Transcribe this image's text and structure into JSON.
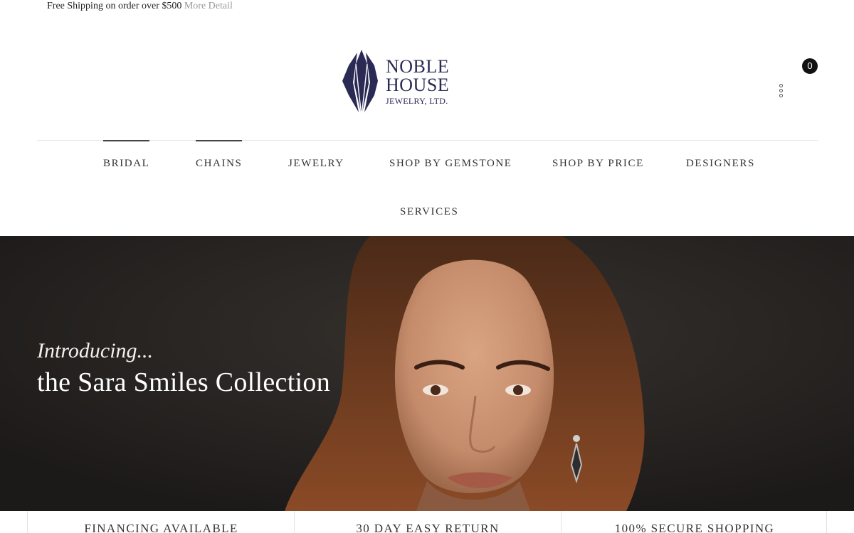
{
  "topbar": {
    "text": "Free Shipping on order over $500",
    "link": "More Detail"
  },
  "logo": {
    "line1": "NOBLE",
    "line2": "HOUSE",
    "line3": "JEWELRY, LTD.",
    "color": "#2a2a55"
  },
  "header": {
    "cart_count": "0",
    "menu_icon": "more-dots-icon"
  },
  "nav": {
    "items": [
      {
        "label": "BRIDAL",
        "active": true
      },
      {
        "label": "CHAINS",
        "active": true
      },
      {
        "label": "JEWELRY",
        "active": false
      },
      {
        "label": "SHOP BY GEMSTONE",
        "active": false
      },
      {
        "label": "SHOP BY PRICE",
        "active": false
      },
      {
        "label": "DESIGNERS",
        "active": false
      },
      {
        "label": "SERVICES",
        "active": false
      }
    ]
  },
  "hero": {
    "intro": "Introducing...",
    "title": "the Sara Smiles Collection"
  },
  "features": [
    {
      "label": "FINANCING AVAILABLE"
    },
    {
      "label": "30 DAY EASY RETURN"
    },
    {
      "label": "100% SECURE SHOPPING"
    }
  ]
}
